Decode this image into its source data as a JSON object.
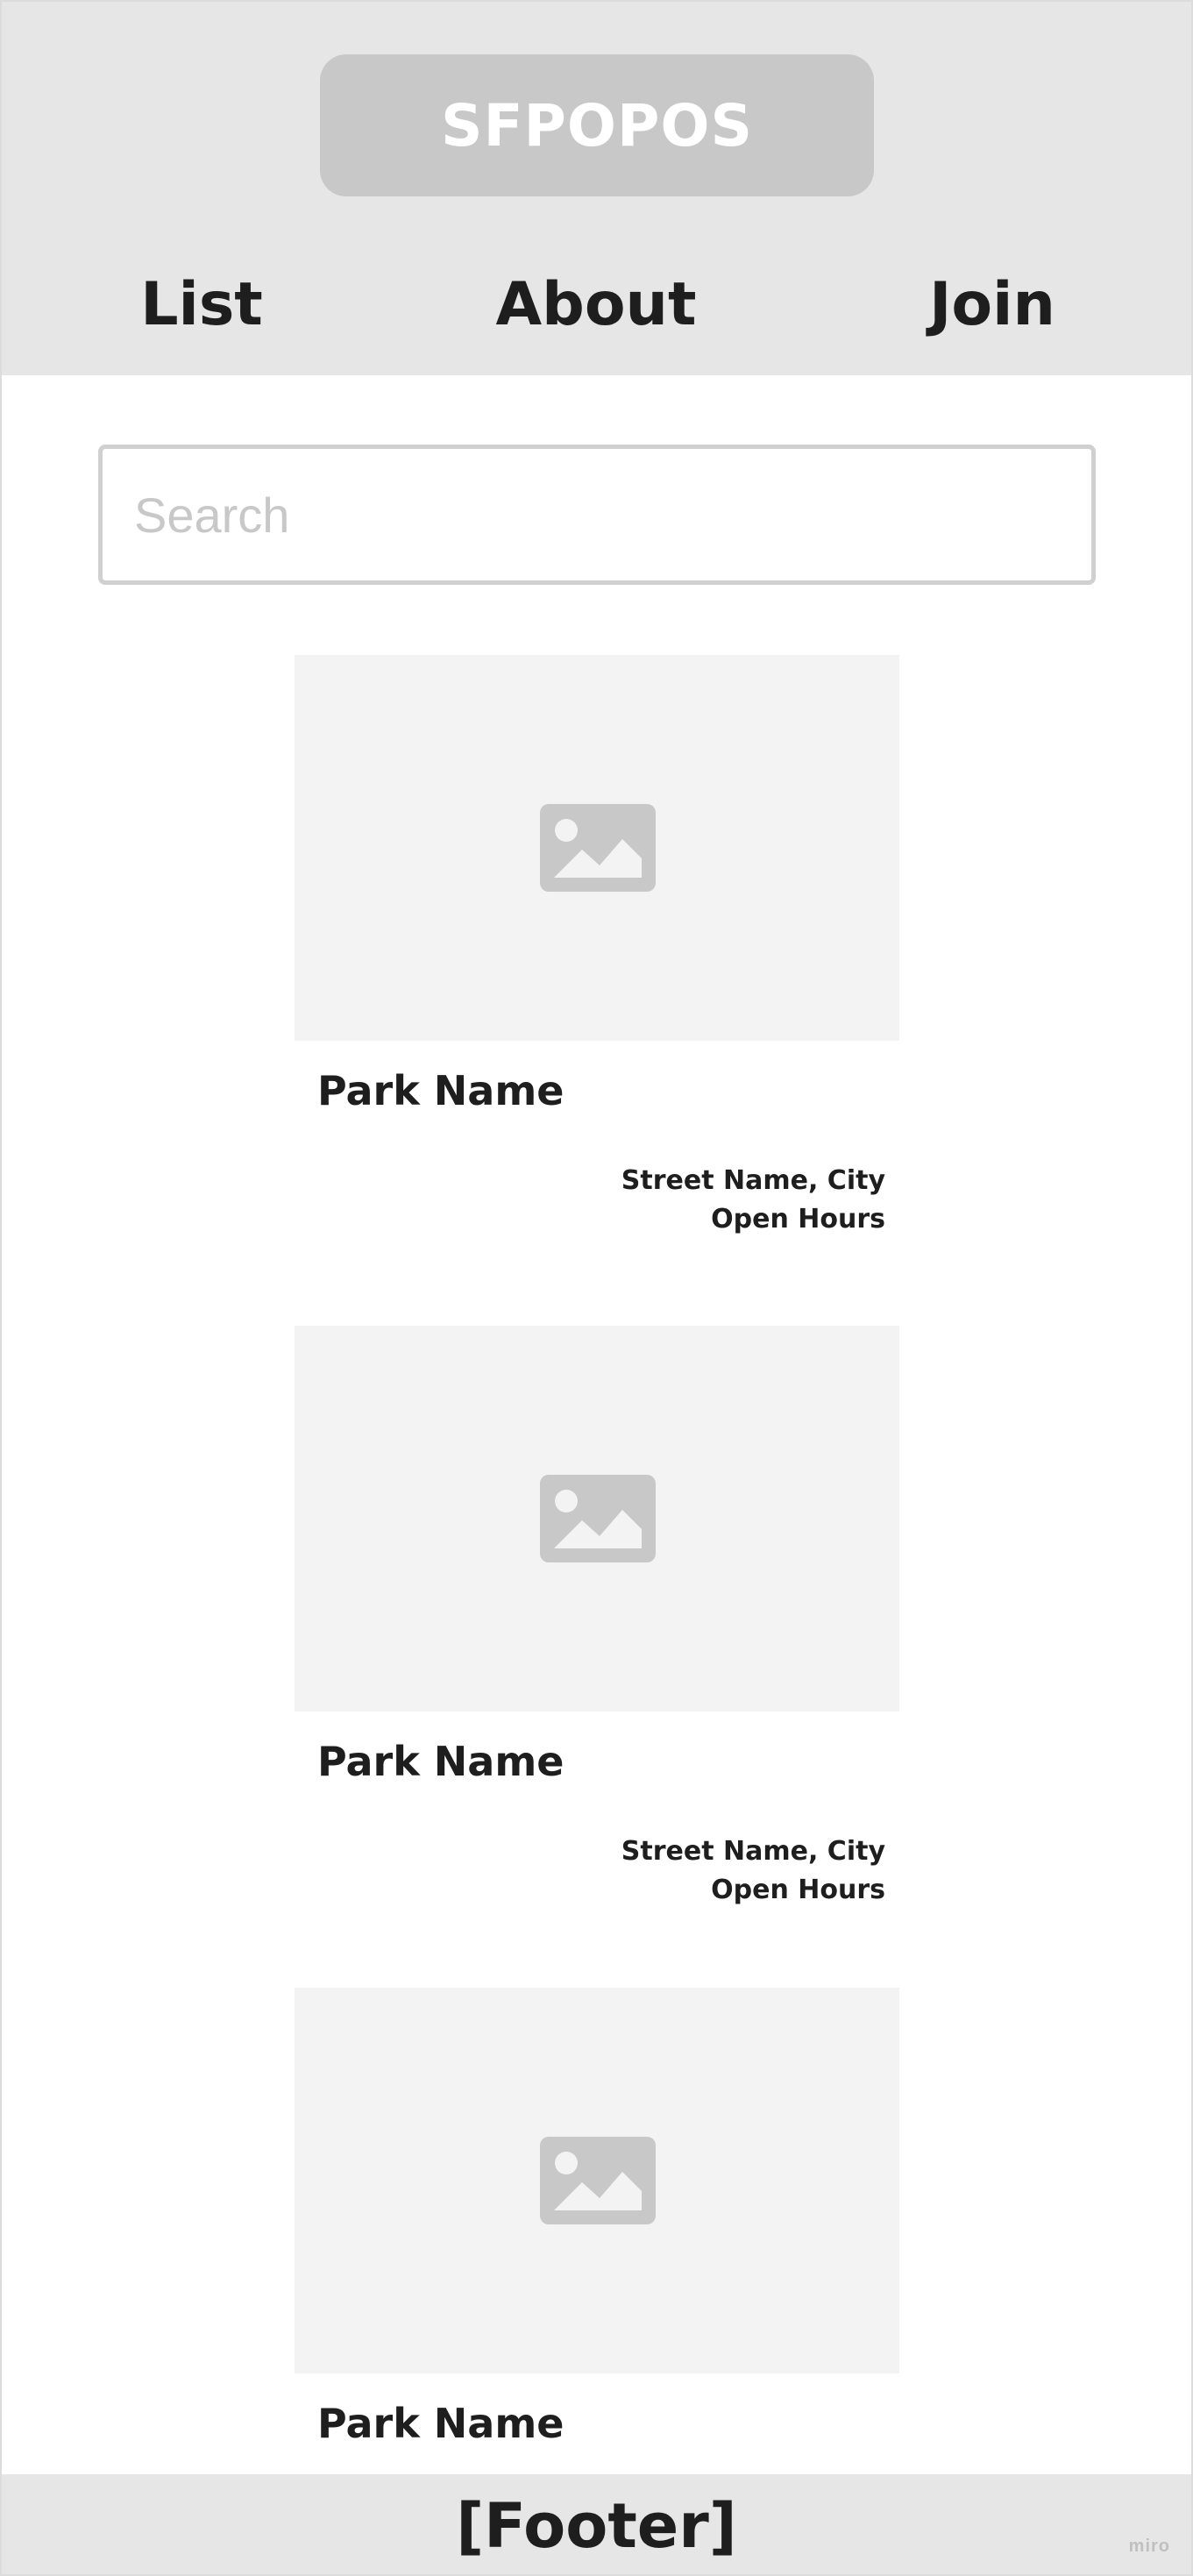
{
  "header": {
    "logo_text": "SFPOPOS",
    "nav": {
      "list": "List",
      "about": "About",
      "join": "Join"
    }
  },
  "search": {
    "placeholder": "Search",
    "value": ""
  },
  "parks": [
    {
      "name": "Park Name",
      "address": "Street Name, City",
      "hours": "Open Hours"
    },
    {
      "name": "Park Name",
      "address": "Street Name, City",
      "hours": "Open Hours"
    },
    {
      "name": "Park Name"
    }
  ],
  "footer": {
    "text": "[Footer]",
    "watermark": "miro"
  },
  "icons": {
    "card_image": "image-placeholder-icon"
  },
  "colors": {
    "header_bg": "#e6e6e6",
    "logo_bg": "#c8c8c8",
    "image_bg": "#f3f3f3",
    "icon": "#c8c8c8",
    "text": "#1e1e1e"
  }
}
